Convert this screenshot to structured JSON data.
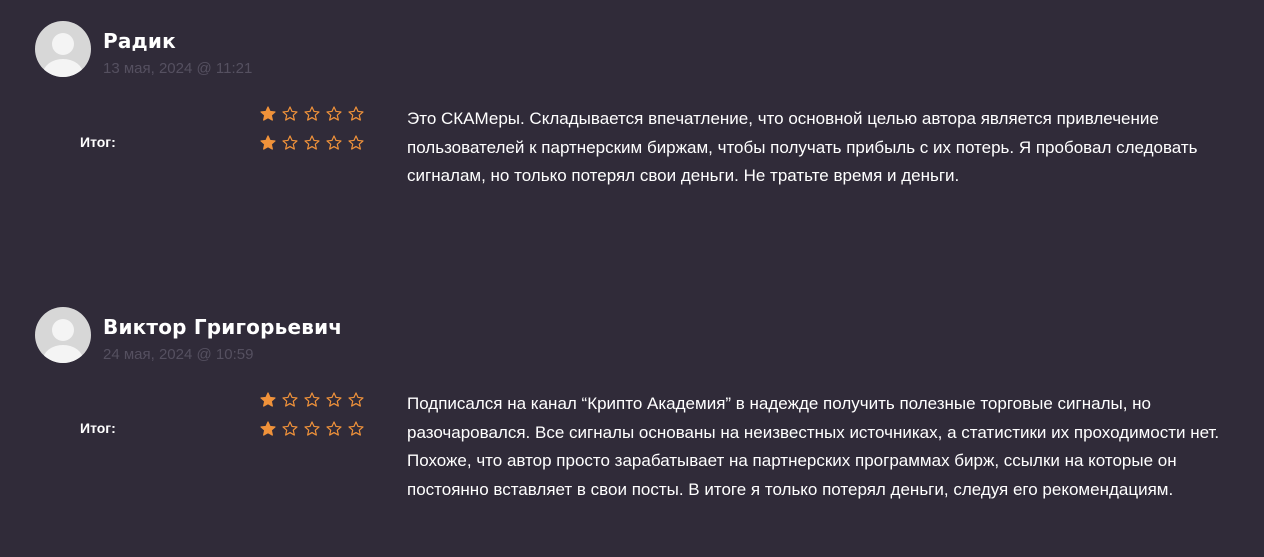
{
  "reviews": [
    {
      "author": "Радик",
      "date": "13 мая, 2024 @ 11:21",
      "total_label": "Итог:",
      "rating_rows": [
        1,
        1
      ],
      "max_stars": 5,
      "text": "Это СКАМеры. Складывается впечатление, что основной целью автора является привлечение пользователей к партнерским биржам, чтобы получать прибыль с их потерь. Я пробовал следовать сигналам, но только потерял свои деньги. Не тратьте время и деньги."
    },
    {
      "author": "Виктор Григорьевич",
      "date": "24 мая, 2024 @ 10:59",
      "total_label": "Итог:",
      "rating_rows": [
        1,
        1
      ],
      "max_stars": 5,
      "text": "Подписался на канал “Крипто Академия” в надежде получить полезные торговые сигналы, но разочаровался. Все сигналы основаны на неизвестных источниках, а статистики их проходимости нет. Похоже, что автор просто зарабатывает на партнерских программах бирж, ссылки на которые он постоянно вставляет в свои посты. В итоге я только потерял деньги, следуя его рекомендациям."
    }
  ],
  "icons": {
    "star_filled": "star-filled-icon",
    "star_empty": "star-empty-icon",
    "avatar": "user-avatar-icon"
  },
  "colors": {
    "background": "#302b39",
    "star": "#f0923a",
    "date": "#555060",
    "text": "#ffffff"
  }
}
